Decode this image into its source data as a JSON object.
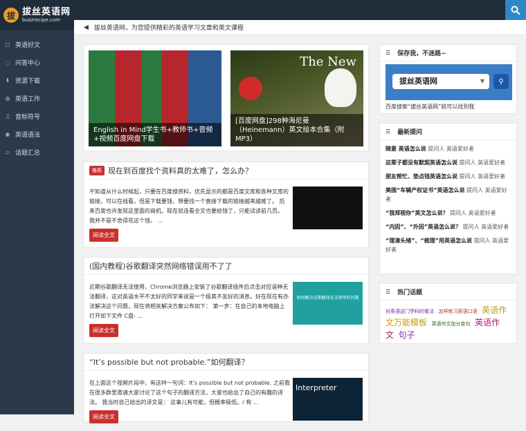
{
  "header": {
    "logo_cn": "拔丝英语网",
    "logo_en": "buzzrecipe.com",
    "logo_mark": "拔",
    "search_icon": "search-icon"
  },
  "sidebar": {
    "items": [
      {
        "label": "英语好文",
        "icon": "bookmark-icon",
        "glyph": "◻"
      },
      {
        "label": "问答中心",
        "icon": "question-icon",
        "glyph": "◌"
      },
      {
        "label": "资源下载",
        "icon": "download-icon",
        "glyph": "⬇"
      },
      {
        "label": "英语工作",
        "icon": "github-icon",
        "glyph": "◍"
      },
      {
        "label": "音标符号",
        "icon": "music-icon",
        "glyph": "♫"
      },
      {
        "label": "英语语法",
        "icon": "dashboard-icon",
        "glyph": "◉"
      },
      {
        "label": "话题汇总",
        "icon": "comments-icon",
        "glyph": "▱"
      }
    ]
  },
  "notice": {
    "text": "拔丝英语网，为您提供精彩的英语学习文章和英文课程"
  },
  "slider": {
    "slides": [
      {
        "caption": "English in Mind学生书+教师书+音频+视频百度网盘下载"
      },
      {
        "caption": "[百度网盘]298种海尼曼（Heinemann）英文绘本合集（附MP3）",
        "overlay": "The New"
      }
    ]
  },
  "posts": [
    {
      "badge": "推荐",
      "title": "现在到百度找个资料真的太难了，怎么办？",
      "excerpt": "不知道从什么时候起，只要在百度搜资料，优先显示的都是百度文库和各种文库的链接，可以在线看，但是下载要钱，想要找一个直接下载的链接越来越难了。 后来百度也许发现这里面的商机，现在就连看全文也要给钱了，只能试读前几页。 我并不是不舍得花这个钱， ...",
      "read_label": "阅读全文"
    },
    {
      "badge": "",
      "title": "(国内教程)谷歌翻译突然网络错误用不了了",
      "excerpt": "近期谷歌翻译无法使用，Chrome浏览器上安装了谷歌翻译插件后点击对应语种无法翻译，这对英语水平不太好的同学来说是一个极其不友好的消息。好在现在有办法解决这个问题，现在将相关解决方案公布如下： 第一步：在自己的本地电脑上打开如下文件 C盘- ...",
      "read_label": "阅读全文",
      "thumb_text": "如何解决谷歌翻译无法使用的问题"
    },
    {
      "badge": "",
      "title": "“It’s possible but not probable.”如何翻译？",
      "excerpt": "在上面这个视频片段中，有这样一句词：It’s possible but not probable. 之前我在很多群里邀请大家讨论了这个句子的翻译方法，大家也给出了自己的有趣的译法。 我当时自己给出的译文是： 这事儿有可能，但概率极低。/ 有 ...",
      "read_label": "阅读全文",
      "thumb_text": "Interpreter"
    }
  ],
  "widgets": {
    "save": {
      "title": "保存我，不迷路~",
      "search_value": "拔丝英语网",
      "tip": "百度搜索“拔丝英语网”就可以找到我"
    },
    "latest": {
      "title": "最新提问",
      "items": [
        {
          "title": "随意 英语怎么说",
          "tail": "提问人 英语爱好者"
        },
        {
          "title": "这辈子都没有默契英语怎么说",
          "tail": "提问人 英语爱好者"
        },
        {
          "title": "朋友帮忙、垫点钱英语怎么说",
          "tail": "提问人 英语爱好者"
        },
        {
          "title": "美国“车辆产权证书”英语怎么说",
          "tail": "提问人 英语爱好者"
        },
        {
          "title": "“我郑视你”英文怎么说？",
          "tail": "提问人 英语爱好者"
        },
        {
          "title": "“内因”、“外因”英语怎么说？",
          "tail": "提问人 英语爱好者"
        },
        {
          "title": "“理清头绪”、“梳理”用英语怎么说",
          "tail": "提问人 英语爱好者"
        }
      ]
    },
    "topics": {
      "title": "热门话题",
      "tags": [
        "对英语这门学科的看法",
        "怎样练习英语口语",
        "英语作文万能模板",
        "英语作文加分金句",
        "英语作文",
        "句子"
      ]
    }
  }
}
